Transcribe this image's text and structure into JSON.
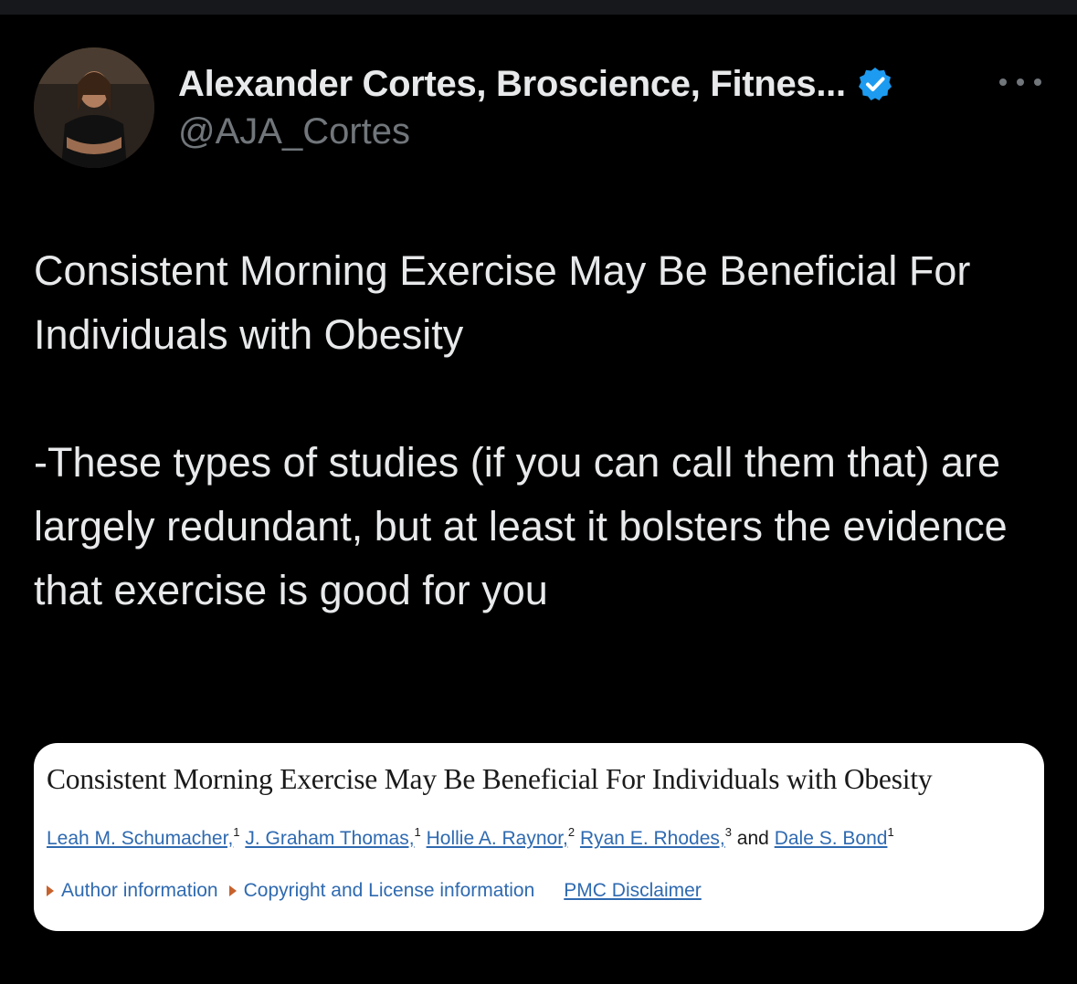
{
  "author": {
    "display_name": "Alexander Cortes, Broscience, Fitnes...",
    "handle": "@AJA_Cortes"
  },
  "tweet": {
    "paragraph1": "Consistent Morning Exercise May Be Beneficial For Individuals with Obesity",
    "paragraph2": "-These types of studies (if you can call them that) are largely redundant, but at least it bolsters the evidence that exercise is good for you"
  },
  "card": {
    "title": "Consistent Morning Exercise May Be Beneficial For Individuals with Obesity",
    "authors": [
      {
        "name": "Leah M. Schumacher,",
        "sup": "1"
      },
      {
        "name": "J. Graham Thomas,",
        "sup": "1"
      },
      {
        "name": "Hollie A. Raynor,",
        "sup": "2"
      },
      {
        "name": "Ryan E. Rhodes,",
        "sup": "3"
      },
      {
        "name": "Dale S. Bond",
        "sup": "1"
      }
    ],
    "and_text": "and",
    "links": {
      "author_info": "Author information",
      "copyright": "Copyright and License information",
      "disclaimer": "PMC Disclaimer"
    }
  },
  "colors": {
    "background": "#000000",
    "text": "#e7e9ea",
    "muted": "#71767b",
    "verified": "#1d9bf0",
    "link": "#2f6ab0"
  },
  "icons": {
    "verified": "verified-badge-icon",
    "more": "more-dots-icon"
  }
}
